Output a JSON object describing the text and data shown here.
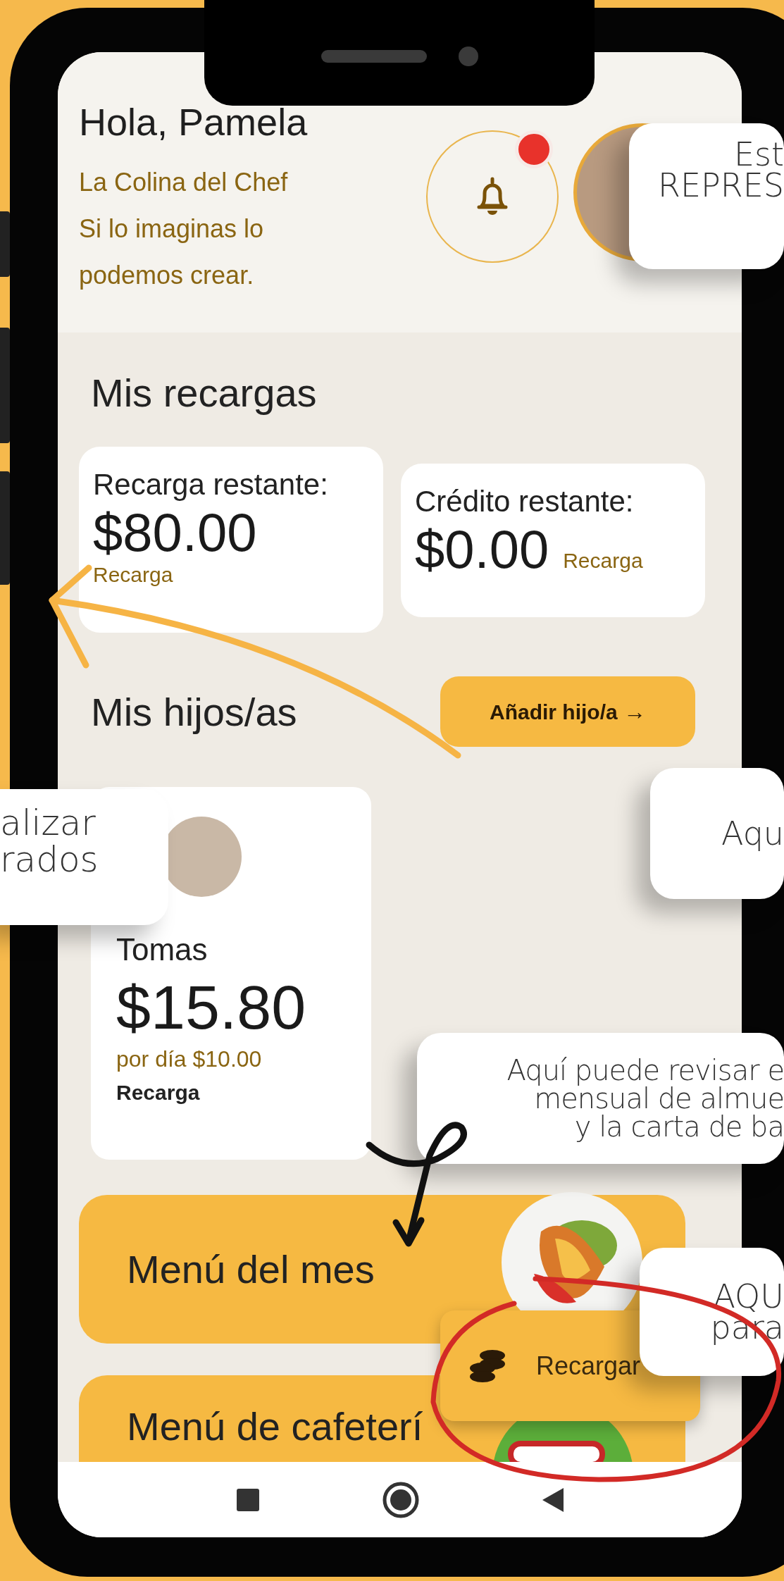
{
  "header": {
    "greeting": "Hola, Pamela",
    "business": "La Colina del Chef",
    "slogan_lines": [
      "Si lo imaginas lo",
      "podemos crear."
    ],
    "notification": {
      "unread": true
    }
  },
  "recharges": {
    "title": "Mis recargas",
    "cards": [
      {
        "label": "Recarga restante:",
        "amount": "$80.00",
        "action": "Recarga"
      },
      {
        "label": "Crédito restante:",
        "amount": "$0.00",
        "action": "Recarga"
      }
    ]
  },
  "children": {
    "title": "Mis hijos/as",
    "add_button": {
      "label": "Añadir hijo/a",
      "icon": "→"
    },
    "items": [
      {
        "name": "Tomas",
        "balance": "$15.80",
        "daily": "por día $10.00",
        "action": "Recarga"
      }
    ]
  },
  "menus": [
    {
      "label": "Menú del mes"
    },
    {
      "label": "Menú de cafeterí"
    }
  ],
  "recharge_button": {
    "label": "Recargar"
  },
  "annotations": [
    {
      "lines": [
        "Est",
        "REPRES"
      ]
    },
    {
      "lines": [
        "alizar",
        "rados"
      ]
    },
    {
      "lines": [
        "Aqu"
      ]
    },
    {
      "lines": [
        "Aquí puede revisar e",
        "mensual de almue",
        "y la carta de ba"
      ]
    },
    {
      "lines": [
        "AQU",
        "para"
      ]
    }
  ]
}
